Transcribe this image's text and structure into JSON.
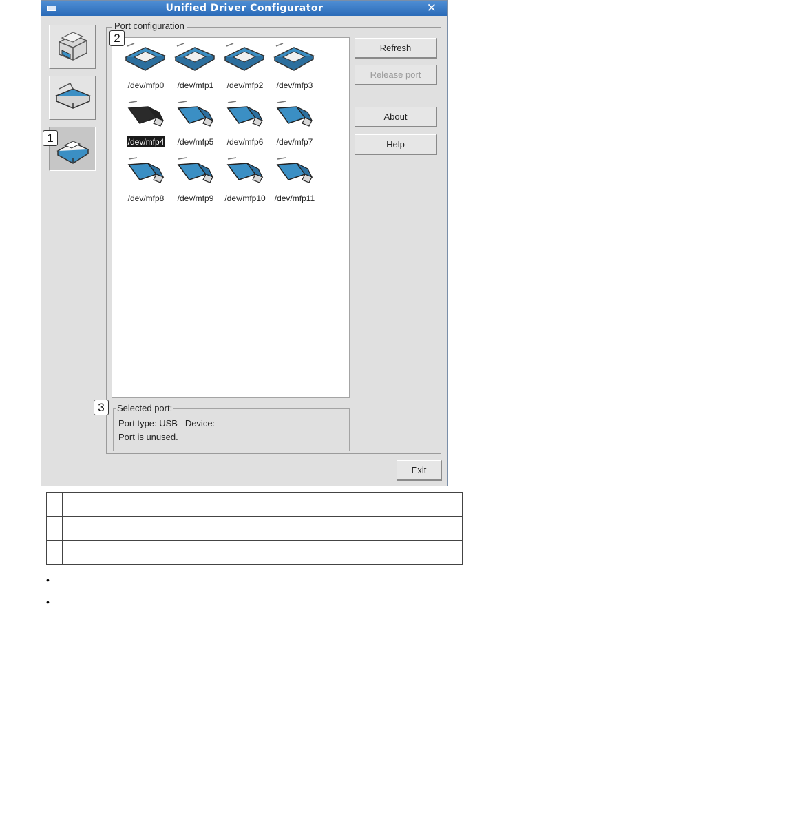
{
  "window": {
    "title": "Unified Driver Configurator",
    "close_glyph": "✕"
  },
  "sidebar": {
    "items": [
      {
        "name": "printers-configuration",
        "icon": "printer-icon",
        "active": false
      },
      {
        "name": "scanners-configuration",
        "icon": "scanner-icon",
        "active": false
      },
      {
        "name": "ports-configuration",
        "icon": "port-icon",
        "active": true
      }
    ]
  },
  "port_configuration": {
    "legend": "Port configuration",
    "ports": [
      {
        "label": "/dev/mfp0",
        "icon": "parallel-port-icon"
      },
      {
        "label": "/dev/mfp1",
        "icon": "parallel-port-icon"
      },
      {
        "label": "/dev/mfp2",
        "icon": "parallel-port-icon"
      },
      {
        "label": "/dev/mfp3",
        "icon": "parallel-port-icon"
      },
      {
        "label": "/dev/mfp4",
        "icon": "usb-port-icon",
        "selected": true
      },
      {
        "label": "/dev/mfp5",
        "icon": "usb-port-icon"
      },
      {
        "label": "/dev/mfp6",
        "icon": "usb-port-icon"
      },
      {
        "label": "/dev/mfp7",
        "icon": "usb-port-icon"
      },
      {
        "label": "/dev/mfp8",
        "icon": "usb-port-icon"
      },
      {
        "label": "/dev/mfp9",
        "icon": "usb-port-icon"
      },
      {
        "label": "/dev/mfp10",
        "icon": "usb-port-icon"
      },
      {
        "label": "/dev/mfp11",
        "icon": "usb-port-icon"
      }
    ]
  },
  "buttons": {
    "refresh": "Refresh",
    "release_port": "Release port",
    "about": "About",
    "help": "Help",
    "exit": "Exit"
  },
  "selected_port": {
    "legend": "Selected port:",
    "line1": "Port type: USB   Device:",
    "line2": "Port is unused."
  },
  "callouts": [
    "1",
    "2",
    "3"
  ],
  "colors": {
    "titlebar": "#2a6bb8",
    "icon_blue": "#3b8fc4",
    "selected_bg": "#1a1a1a"
  }
}
